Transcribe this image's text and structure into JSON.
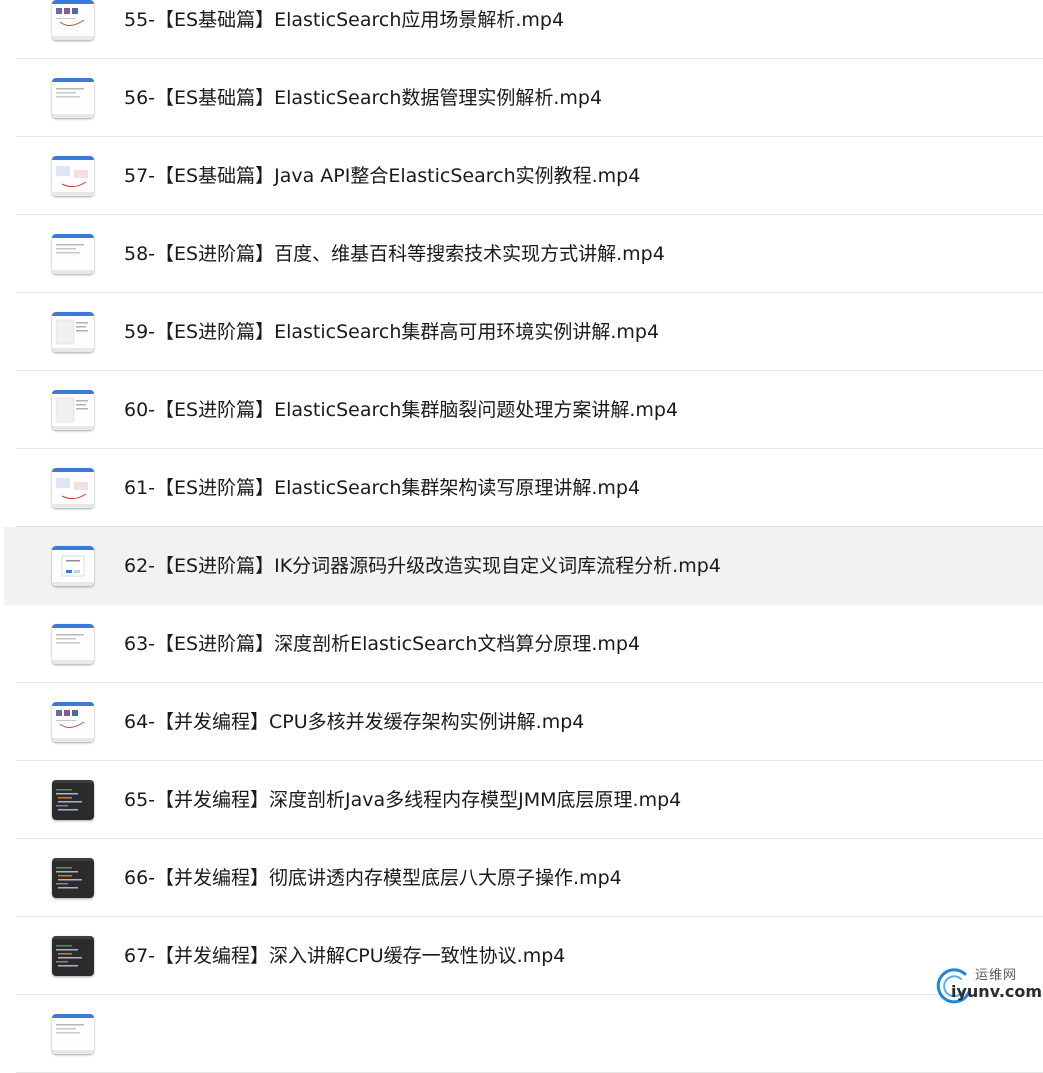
{
  "files": [
    {
      "name": "55-【ES基础篇】ElasticSearch应用场景解析.mp4",
      "thumb": "light-marked",
      "selected": false
    },
    {
      "name": "56-【ES基础篇】ElasticSearch数据管理实例解析.mp4",
      "thumb": "light",
      "selected": false
    },
    {
      "name": "57-【ES基础篇】Java API整合ElasticSearch实例教程.mp4",
      "thumb": "light-diagram",
      "selected": false
    },
    {
      "name": "58-【ES进阶篇】百度、维基百科等搜索技术实现方式讲解.mp4",
      "thumb": "light",
      "selected": false
    },
    {
      "name": "59-【ES进阶篇】ElasticSearch集群高可用环境实例讲解.mp4",
      "thumb": "light-panel",
      "selected": false
    },
    {
      "name": "60-【ES进阶篇】ElasticSearch集群脑裂问题处理方案讲解.mp4",
      "thumb": "light-panel",
      "selected": false
    },
    {
      "name": "61-【ES进阶篇】ElasticSearch集群架构读写原理讲解.mp4",
      "thumb": "light-diagram",
      "selected": false
    },
    {
      "name": "62-【ES进阶篇】IK分词器源码升级改造实现自定义词库流程分析.mp4",
      "thumb": "light-dialog",
      "selected": true
    },
    {
      "name": "63-【ES进阶篇】深度剖析ElasticSearch文档算分原理.mp4",
      "thumb": "light",
      "selected": false
    },
    {
      "name": "64-【并发编程】CPU多核并发缓存架构实例讲解.mp4",
      "thumb": "light-marked",
      "selected": false
    },
    {
      "name": "65-【并发编程】深度剖析Java多线程内存模型JMM底层原理.mp4",
      "thumb": "dark",
      "selected": false
    },
    {
      "name": "66-【并发编程】彻底讲透内存模型底层八大原子操作.mp4",
      "thumb": "dark",
      "selected": false
    },
    {
      "name": "67-【并发编程】深入讲解CPU缓存一致性协议.mp4",
      "thumb": "dark",
      "selected": false
    },
    {
      "name": "",
      "thumb": "light",
      "selected": false
    }
  ],
  "watermark": {
    "top": "运维网",
    "bottom": "iyunv.com",
    "logo_icon": "swirl-logo-icon",
    "logo_color": "#1e88d8"
  },
  "colors": {
    "selected_row": "#f2f2f2",
    "divider": "#e6e6e6",
    "text": "#1a1a1a"
  }
}
